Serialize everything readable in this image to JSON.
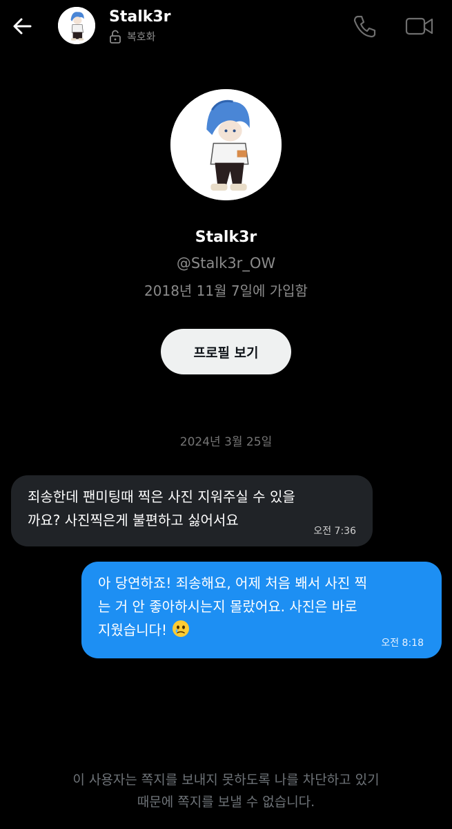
{
  "header": {
    "name": "Stalk3r",
    "encryption_label": "복호화"
  },
  "profile": {
    "name": "Stalk3r",
    "handle": "@Stalk3r_OW",
    "joined": "2018년 11월 7일에 가입함",
    "view_profile_label": "프로필 보기"
  },
  "conversation": {
    "date": "2024년 3월 25일",
    "messages": [
      {
        "direction": "incoming",
        "lines": [
          "죄송한데 팬미팅때 찍은 사진 지워주실 수 있을",
          "까요? 사진찍은게 불편하고 싫어서요"
        ],
        "time": "오전 7:36"
      },
      {
        "direction": "outgoing",
        "lines": [
          "아 당연하죠! 죄송해요, 어제 처음 봬서 사진 찍",
          "는 거 안 좋아하시는지 몰랐어요. 사진은 바로",
          "지웠습니다!"
        ],
        "emoji": "face-holding-back-tears-emoji",
        "time": "오전 8:18"
      }
    ]
  },
  "footer": {
    "blocked_notice_lines": [
      "이 사용자는 쪽지를 보내지 못하도록 나를 차단하고 있기",
      "때문에 쪽지를 보낼 수 없습니다."
    ]
  },
  "colors": {
    "background": "#000000",
    "incoming_bubble": "#202327",
    "outgoing_bubble": "#1d8ff3",
    "secondary_text": "#8b8b8b"
  }
}
